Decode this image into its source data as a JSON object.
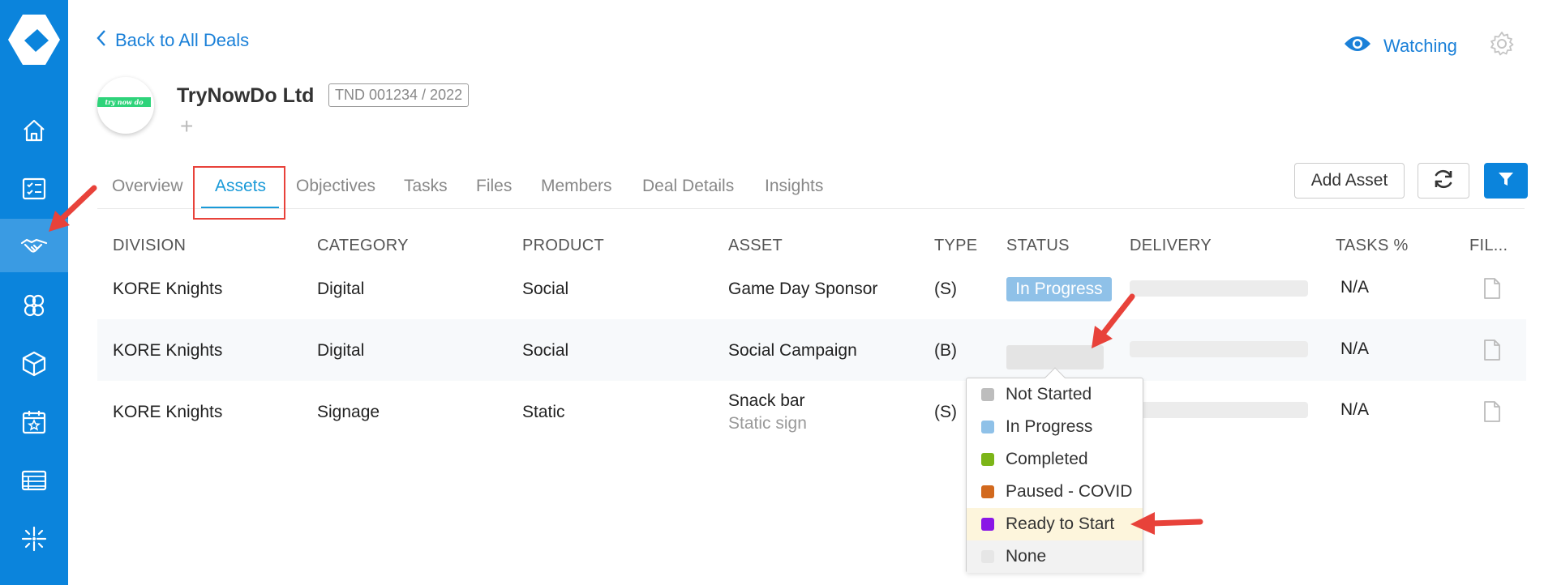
{
  "nav": {
    "back_label": "Back to All Deals",
    "watching_label": "Watching"
  },
  "deal": {
    "company_name": "TryNowDo Ltd",
    "code": "TND 001234 / 2022",
    "logo_text": "try now do",
    "add_symbol": "+"
  },
  "tabs": [
    {
      "label": "Overview"
    },
    {
      "label": "Assets"
    },
    {
      "label": "Objectives"
    },
    {
      "label": "Tasks"
    },
    {
      "label": "Files"
    },
    {
      "label": "Members"
    },
    {
      "label": "Deal Details"
    },
    {
      "label": "Insights"
    }
  ],
  "active_tab": "Assets",
  "toolbar": {
    "add_asset_label": "Add Asset"
  },
  "table": {
    "headers": [
      "DIVISION",
      "CATEGORY",
      "PRODUCT",
      "ASSET",
      "TYPE",
      "STATUS",
      "DELIVERY",
      "TASKS %",
      "FIL..."
    ],
    "rows": [
      {
        "division": "KORE Knights",
        "category": "Digital",
        "product": "Social",
        "asset": "Game Day Sponsor",
        "asset_sub": "",
        "type": "(S)",
        "status": "In Progress",
        "tasks": "N/A"
      },
      {
        "division": "KORE Knights",
        "category": "Digital",
        "product": "Social",
        "asset": "Social Campaign",
        "asset_sub": "",
        "type": "(B)",
        "status": "",
        "tasks": "N/A"
      },
      {
        "division": "KORE Knights",
        "category": "Signage",
        "product": "Static",
        "asset": "Snack bar",
        "asset_sub": "Static sign",
        "type": "(S)",
        "status": "",
        "tasks": "N/A"
      }
    ]
  },
  "status_dropdown": {
    "options": [
      {
        "label": "Not Started",
        "color": "#bdbdbd"
      },
      {
        "label": "In Progress",
        "color": "#8fc1e8"
      },
      {
        "label": "Completed",
        "color": "#7cb518"
      },
      {
        "label": "Paused - COVID",
        "color": "#d2691e"
      },
      {
        "label": "Ready to Start",
        "color": "#8a17e6"
      },
      {
        "label": "None",
        "color": "#e6e6e6"
      }
    ],
    "highlighted": "Ready to Start"
  },
  "colors": {
    "sidebar": "#0b84dc",
    "accent": "#1a80d8",
    "in_progress_pill": "#8fc1e8",
    "annotation": "#e8423a"
  },
  "icons": {
    "sidebar": [
      "logo-icon",
      "home-icon",
      "checklist-icon",
      "handshake-icon",
      "group-icon",
      "box-icon",
      "calendar-star-icon",
      "table-icon",
      "sparkle-icon"
    ]
  }
}
